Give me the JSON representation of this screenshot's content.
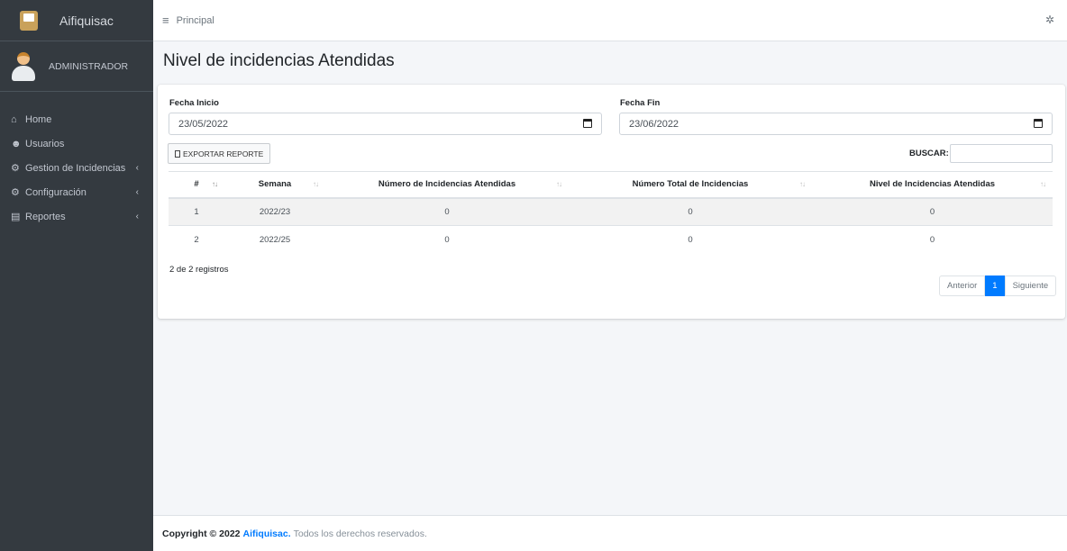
{
  "sidebar": {
    "brand": "Aifiquisac",
    "user": "ADMINISTRADOR",
    "items": [
      {
        "label": "Home",
        "icon": "home-icon",
        "chevron": ""
      },
      {
        "label": "Usuarios",
        "icon": "users-icon",
        "chevron": ""
      },
      {
        "label": "Gestion de Incidencias",
        "icon": "cogs-icon",
        "chevron": "‹"
      },
      {
        "label": "Configuración",
        "icon": "cogs-icon",
        "chevron": "‹"
      },
      {
        "label": "Reportes",
        "icon": "chart-icon",
        "chevron": "‹"
      }
    ]
  },
  "topbar": {
    "breadcrumb": "Principal"
  },
  "page": {
    "title": "Nivel de incidencias Atendidas"
  },
  "filters": {
    "start_label": "Fecha Inicio",
    "start_value": "23/05/2022",
    "end_label": "Fecha Fin",
    "end_value": "23/06/2022"
  },
  "toolbar": {
    "export_label": "EXPORTAR REPORTE",
    "search_label": "BUSCAR:",
    "search_value": ""
  },
  "table": {
    "headers": [
      "#",
      "Semana",
      "Número de Incidencias Atendidas",
      "Número Total de Incidencias",
      "Nivel de Incidencias Atendidas"
    ],
    "rows": [
      [
        "1",
        "2022/23",
        "0",
        "0",
        "0"
      ],
      [
        "2",
        "2022/25",
        "0",
        "0",
        "0"
      ]
    ]
  },
  "info": "2 de 2 registros",
  "pagination": {
    "prev": "Anterior",
    "current": "1",
    "next": "Siguiente"
  },
  "footer": {
    "copyright": "Copyright © 2022",
    "brand": "Aifiquisac.",
    "rights": "Todos los derechos reservados."
  },
  "colors": {
    "sidebar": "#343a40",
    "accent": "#007bff",
    "background": "#f4f6f9"
  }
}
